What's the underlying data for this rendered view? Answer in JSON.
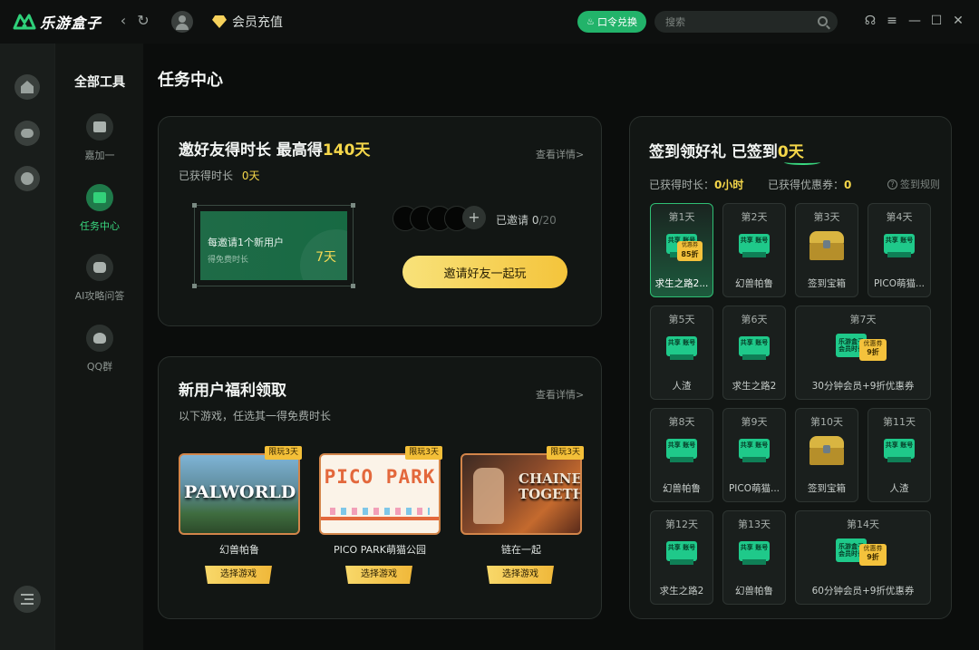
{
  "app": {
    "name": "乐游盒子",
    "vip_label": "会员充值",
    "redeem_label": "口令兑换",
    "search_placeholder": "搜索"
  },
  "sidebar": {
    "title": "全部工具",
    "tools": [
      {
        "label": "嘉加一",
        "icon": "plus-one-icon"
      },
      {
        "label": "任务中心",
        "icon": "task-check-icon",
        "active": true
      },
      {
        "label": "AI攻略问答",
        "icon": "robot-icon"
      },
      {
        "label": "QQ群",
        "icon": "qq-icon"
      }
    ]
  },
  "page": {
    "title": "任务中心"
  },
  "invite": {
    "title_prefix": "邀好友得时长 最高得",
    "title_highlight": "140天",
    "more": "查看详情>",
    "earned_label": "已获得时长",
    "earned_value": "0天",
    "reward_line1": "每邀请1个新用户",
    "reward_line2": "得免费时长",
    "reward_days": "7天",
    "invited_label": "已邀请 0",
    "invited_total": "/20",
    "button": "邀请好友一起玩"
  },
  "newuser": {
    "title": "新用户福利领取",
    "more": "查看详情>",
    "subtitle": "以下游戏，任选其一得免费时长",
    "games": [
      {
        "name": "幻兽帕鲁",
        "badge": "限玩3天",
        "art_text": "PALWORLD",
        "button": "选择游戏"
      },
      {
        "name": "PICO PARK萌猫公园",
        "badge": "限玩3天",
        "art_text": "PICO PARK",
        "button": "选择游戏"
      },
      {
        "name": "链在一起",
        "badge": "限玩3天",
        "art_text": "CHAINED TOGETHER",
        "button": "选择游戏"
      }
    ]
  },
  "checkin": {
    "title_prefix": "签到领好礼 已签到",
    "title_highlight": "0天",
    "earned_label": "已获得时长：",
    "earned_value": "0小时",
    "coupon_label": "已获得优惠券：",
    "coupon_value": "0",
    "rules": "签到规则",
    "days": [
      {
        "day": "第1天",
        "name": "求生之路2...",
        "reward": "ticket-coupon",
        "ticket": "共享 账号",
        "coupon_top": "优惠券",
        "coupon": "85折",
        "active": true
      },
      {
        "day": "第2天",
        "name": "幻兽帕鲁",
        "reward": "ticket",
        "ticket": "共享 账号"
      },
      {
        "day": "第3天",
        "name": "签到宝箱",
        "reward": "chest"
      },
      {
        "day": "第4天",
        "name": "PICO萌猫...",
        "reward": "ticket",
        "ticket": "共享 账号"
      },
      {
        "day": "第5天",
        "name": "人渣",
        "reward": "ticket",
        "ticket": "共享 账号"
      },
      {
        "day": "第6天",
        "name": "求生之路2",
        "reward": "ticket",
        "ticket": "共享 账号"
      },
      {
        "day": "第7天",
        "name": "30分钟会员+9折优惠券",
        "reward": "combo",
        "vip": "乐游盒子 会员时长",
        "coupon_top": "优惠券",
        "coupon": "9折",
        "wide": true
      },
      {
        "day": "第8天",
        "name": "幻兽帕鲁",
        "reward": "ticket",
        "ticket": "共享 账号"
      },
      {
        "day": "第9天",
        "name": "PICO萌猫...",
        "reward": "ticket",
        "ticket": "共享 账号"
      },
      {
        "day": "第10天",
        "name": "签到宝箱",
        "reward": "chest"
      },
      {
        "day": "第11天",
        "name": "人渣",
        "reward": "ticket",
        "ticket": "共享 账号"
      },
      {
        "day": "第12天",
        "name": "求生之路2",
        "reward": "ticket",
        "ticket": "共享 账号"
      },
      {
        "day": "第13天",
        "name": "幻兽帕鲁",
        "reward": "ticket",
        "ticket": "共享 账号"
      },
      {
        "day": "第14天",
        "name": "60分钟会员+9折优惠券",
        "reward": "combo",
        "vip": "乐游盒子 会员时长",
        "coupon_top": "优惠券",
        "coupon": "9折",
        "wide": true
      }
    ]
  },
  "colors": {
    "accent": "#22b36a",
    "highlight": "#f5d74a",
    "button_gold": "#f4c43b"
  }
}
